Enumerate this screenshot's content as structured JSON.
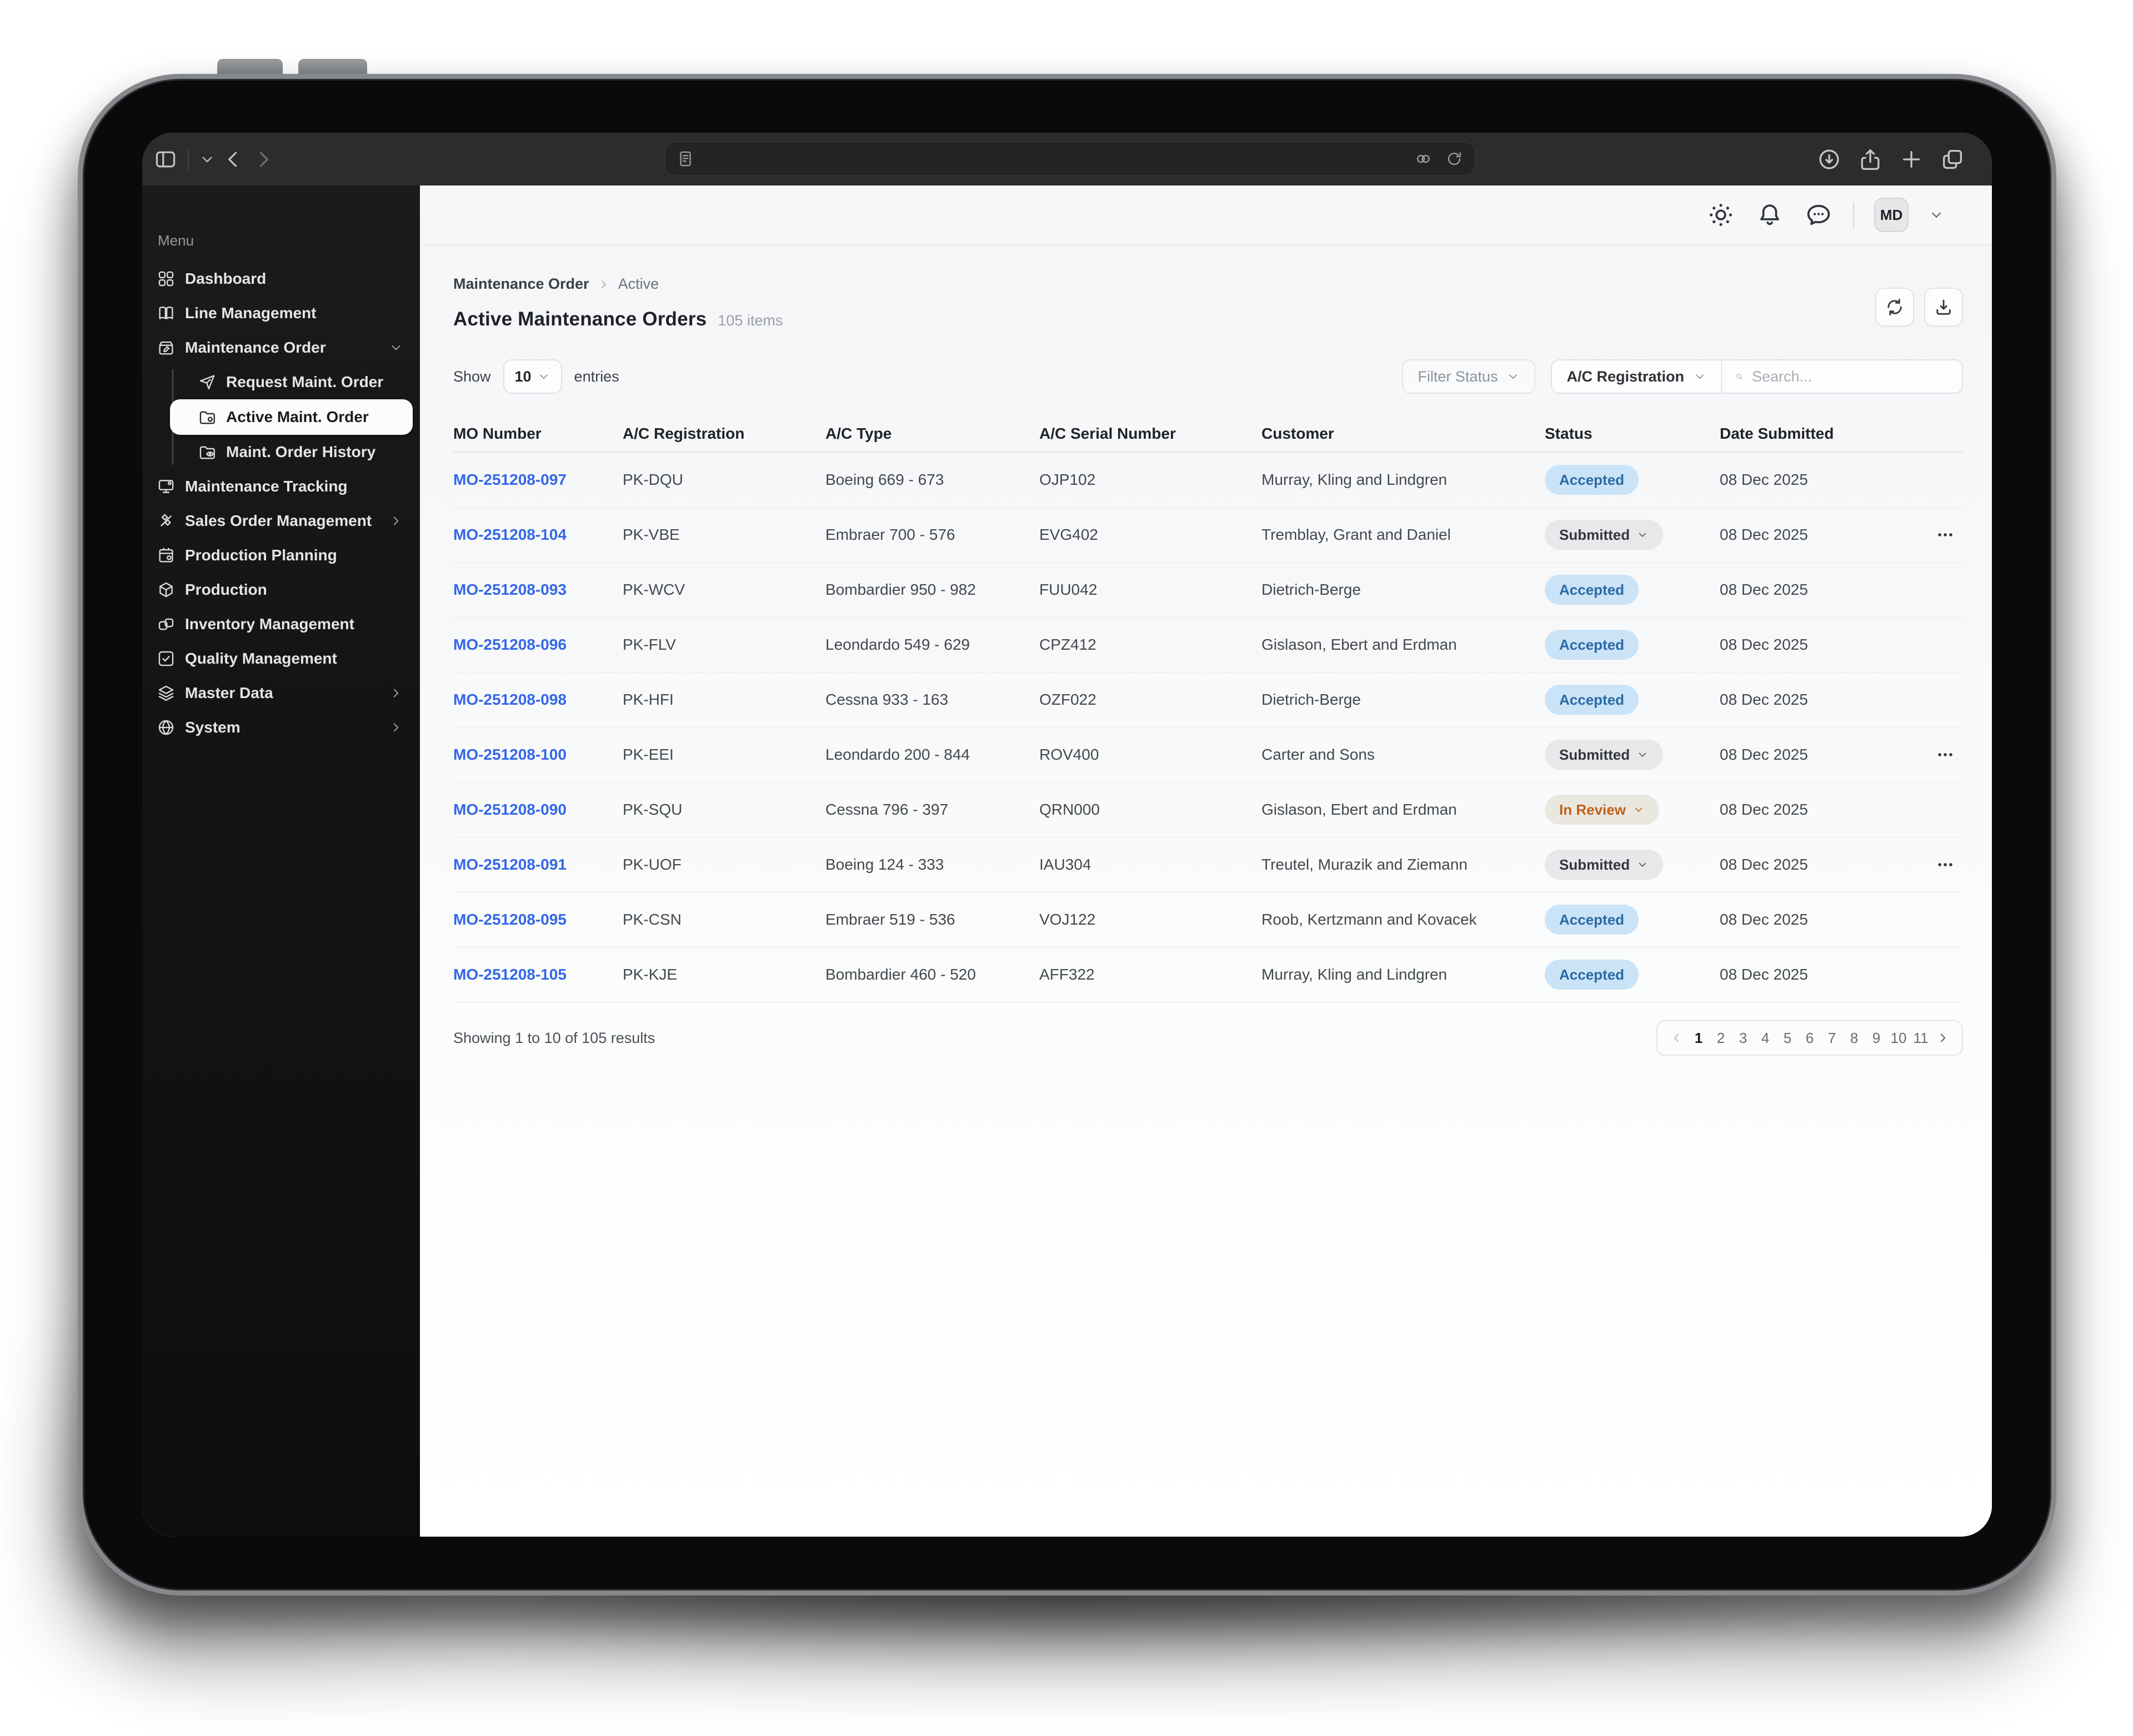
{
  "colors": {
    "link_blue": "#3467e8",
    "accepted_bg": "#cbe3f6",
    "accepted_text": "#2a6aa5",
    "submitted_bg": "#e8e8eb",
    "submitted_text": "#33373c",
    "in_review_bg": "#eae7e1",
    "in_review_text": "#c2601c",
    "sidebar_bg": "#141416",
    "toolbar_bg": "#2c2c2e"
  },
  "browser": {
    "left_icons": [
      "sidebar-panel-icon",
      "chevron-down-icon",
      "back-icon",
      "forward-icon"
    ],
    "url_lead_icon": "reader-icon",
    "url_trail_icons": [
      "passwords-icon",
      "reload-icon"
    ],
    "right_icons": [
      "downloads-icon",
      "share-icon",
      "new-tab-icon",
      "tabs-icon"
    ]
  },
  "app_header": {
    "icons": [
      "theme-icon",
      "notifications-icon",
      "messages-icon"
    ],
    "avatar_initials": "MD"
  },
  "sidebar": {
    "menu_label": "Menu",
    "items": [
      {
        "label": "Dashboard",
        "icon": "dashboard-icon"
      },
      {
        "label": "Line Management",
        "icon": "book-icon"
      },
      {
        "label": "Maintenance Order",
        "icon": "maintenance-order-icon",
        "chevron": "down"
      },
      {
        "label": "Request Maint. Order",
        "icon": "send-icon",
        "child": true
      },
      {
        "label": "Active Maint. Order",
        "icon": "folder-gear-icon",
        "child": true,
        "active": true
      },
      {
        "label": "Maint. Order History",
        "icon": "folder-eye-icon",
        "child": true
      },
      {
        "label": "Maintenance Tracking",
        "icon": "tracking-icon"
      },
      {
        "label": "Sales Order Management",
        "icon": "sales-icon",
        "chevron": "right"
      },
      {
        "label": "Production Planning",
        "icon": "planning-icon"
      },
      {
        "label": "Production",
        "icon": "production-icon"
      },
      {
        "label": "Inventory Management",
        "icon": "inventory-icon"
      },
      {
        "label": "Quality Management",
        "icon": "quality-icon"
      },
      {
        "label": "Master Data",
        "icon": "layers-icon",
        "chevron": "right"
      },
      {
        "label": "System",
        "icon": "globe-icon",
        "chevron": "right"
      }
    ]
  },
  "breadcrumb": {
    "parent": "Maintenance Order",
    "current": "Active"
  },
  "page": {
    "title": "Active Maintenance Orders",
    "count_label": "105 items"
  },
  "controls": {
    "show_label": "Show",
    "page_size": "10",
    "entries_label": "entries",
    "filter_status_label": "Filter Status",
    "category_label": "A/C Registration",
    "search_placeholder": "Search..."
  },
  "table": {
    "columns": [
      "MO Number",
      "A/C Registration",
      "A/C Type",
      "A/C Serial Number",
      "Customer",
      "Status",
      "Date Submitted"
    ],
    "rows": [
      {
        "mo": "MO-251208-097",
        "reg": "PK-DQU",
        "type": "Boeing 669 - 673",
        "serial": "OJP102",
        "customer": "Murray, Kling and Lindgren",
        "status": "Accepted",
        "status_kind": "accepted",
        "date": "08 Dec 2025",
        "menu": false
      },
      {
        "mo": "MO-251208-104",
        "reg": "PK-VBE",
        "type": "Embraer 700 - 576",
        "serial": "EVG402",
        "customer": "Tremblay, Grant and Daniel",
        "status": "Submitted",
        "status_kind": "submitted",
        "date": "08 Dec 2025",
        "menu": true
      },
      {
        "mo": "MO-251208-093",
        "reg": "PK-WCV",
        "type": "Bombardier 950 - 982",
        "serial": "FUU042",
        "customer": "Dietrich-Berge",
        "status": "Accepted",
        "status_kind": "accepted",
        "date": "08 Dec 2025",
        "menu": false
      },
      {
        "mo": "MO-251208-096",
        "reg": "PK-FLV",
        "type": "Leondardo 549 - 629",
        "serial": "CPZ412",
        "customer": "Gislason, Ebert and Erdman",
        "status": "Accepted",
        "status_kind": "accepted",
        "date": "08 Dec 2025",
        "menu": false
      },
      {
        "mo": "MO-251208-098",
        "reg": "PK-HFI",
        "type": "Cessna 933 - 163",
        "serial": "OZF022",
        "customer": "Dietrich-Berge",
        "status": "Accepted",
        "status_kind": "accepted",
        "date": "08 Dec 2025",
        "menu": false
      },
      {
        "mo": "MO-251208-100",
        "reg": "PK-EEI",
        "type": "Leondardo 200 - 844",
        "serial": "ROV400",
        "customer": "Carter and Sons",
        "status": "Submitted",
        "status_kind": "submitted",
        "date": "08 Dec 2025",
        "menu": true
      },
      {
        "mo": "MO-251208-090",
        "reg": "PK-SQU",
        "type": "Cessna 796 - 397",
        "serial": "QRN000",
        "customer": "Gislason, Ebert and Erdman",
        "status": "In Review",
        "status_kind": "in_review",
        "date": "08 Dec 2025",
        "menu": false
      },
      {
        "mo": "MO-251208-091",
        "reg": "PK-UOF",
        "type": "Boeing 124 - 333",
        "serial": "IAU304",
        "customer": "Treutel, Murazik and Ziemann",
        "status": "Submitted",
        "status_kind": "submitted",
        "date": "08 Dec 2025",
        "menu": true
      },
      {
        "mo": "MO-251208-095",
        "reg": "PK-CSN",
        "type": "Embraer 519 - 536",
        "serial": "VOJ122",
        "customer": "Roob, Kertzmann and Kovacek",
        "status": "Accepted",
        "status_kind": "accepted",
        "date": "08 Dec 2025",
        "menu": false
      },
      {
        "mo": "MO-251208-105",
        "reg": "PK-KJE",
        "type": "Bombardier 460 - 520",
        "serial": "AFF322",
        "customer": "Murray, Kling and Lindgren",
        "status": "Accepted",
        "status_kind": "accepted",
        "date": "08 Dec 2025",
        "menu": false
      }
    ]
  },
  "footer": {
    "summary": "Showing 1 to 10 of 105 results",
    "pages": [
      "1",
      "2",
      "3",
      "4",
      "5",
      "6",
      "7",
      "8",
      "9",
      "10",
      "11"
    ],
    "active_page": "1"
  }
}
